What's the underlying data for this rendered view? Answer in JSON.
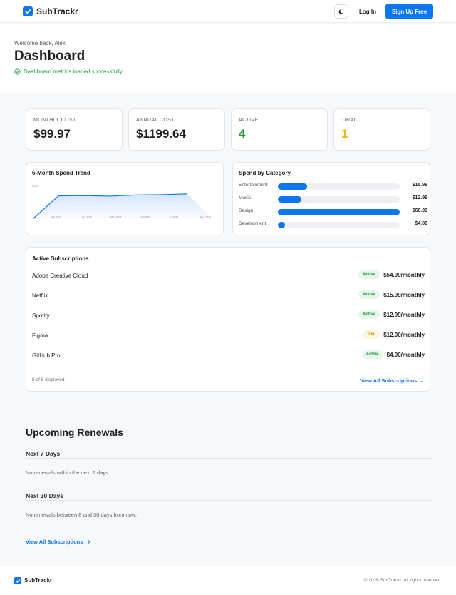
{
  "header": {
    "brand": "SubTrackr",
    "login_label": "Log In",
    "signup_label": "Sign Up Free",
    "theme_icon": "moon-icon"
  },
  "hero": {
    "welcome": "Welcome back, Alex",
    "title": "Dashboard",
    "status": "Dashboard metrics loaded successfully."
  },
  "stats": [
    {
      "label": "MONTHLY COST",
      "value": "$99.97",
      "color": "#1d1f23"
    },
    {
      "label": "ANNUAL COST",
      "value": "$1199.64",
      "color": "#1d1f23"
    },
    {
      "label": "ACTIVE",
      "value": "4",
      "color": "#1b9a3f"
    },
    {
      "label": "TRIAL",
      "value": "1",
      "color": "#e8b90c"
    }
  ],
  "trend": {
    "title": "6-Month Spend Trend",
    "chart_data": {
      "type": "area",
      "y_tick_label": "$100",
      "categories": [
        "Mar 2026",
        "Apr 2026",
        "May 2026",
        "Jun 2026",
        "Jul 2026",
        "Aug 2026"
      ],
      "x_labels": [
        "Mar 2026",
        "Apr 2026",
        "May 2026",
        "Jun 2026",
        "Jul 2026",
        "Aug 2026"
      ],
      "values": [
        0,
        83,
        84,
        82,
        86,
        87,
        90,
        0
      ],
      "ylim": [
        0,
        110
      ]
    }
  },
  "category": {
    "title": "Spend by Category",
    "chart_data": {
      "type": "bar",
      "categories": [
        "Entertainment",
        "Music",
        "Design",
        "Development"
      ],
      "values": [
        15.99,
        12.99,
        66.99,
        4.0
      ],
      "value_labels": [
        "$15.99",
        "$12.99",
        "$66.99",
        "$4.00"
      ],
      "xlim": [
        0,
        66.99
      ]
    }
  },
  "subscriptions": {
    "title": "Active Subscriptions",
    "items": [
      {
        "name": "Adobe Creative Cloud",
        "status": "Active",
        "price": "$54.99/monthly"
      },
      {
        "name": "Netflix",
        "status": "Active",
        "price": "$15.99/monthly"
      },
      {
        "name": "Spotify",
        "status": "Active",
        "price": "$12.99/monthly"
      },
      {
        "name": "Figma",
        "status": "Trial",
        "price": "$12.00/monthly"
      },
      {
        "name": "GitHub Pro",
        "status": "Active",
        "price": "$4.00/monthly"
      }
    ],
    "count_text": "5 of 5 displayed",
    "view_all": "View All Subscriptions →"
  },
  "renewals": {
    "title": "Upcoming Renewals",
    "next7_title": "Next 7 Days",
    "next7_empty": "No renewals within the next 7 days.",
    "next30_title": "Next 30 Days",
    "next30_empty": "No renewals between 8 and 30 days from now.",
    "view_all": "View All Subscriptions"
  },
  "footer": {
    "brand": "SubTrackr",
    "copyright": "© 2026 SubTrackr. All rights reserved."
  },
  "colors": {
    "accent": "#0d76ef",
    "active": "#1b9a3f",
    "trial": "#e8b90c"
  }
}
